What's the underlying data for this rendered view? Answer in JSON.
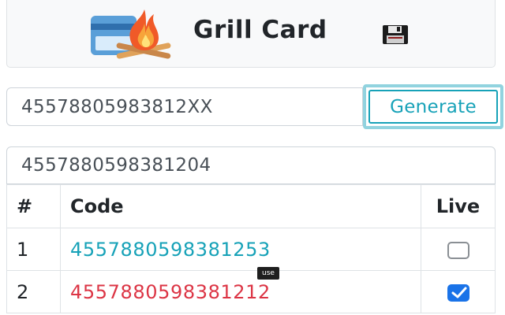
{
  "app": {
    "title": "Grill Card"
  },
  "generator": {
    "pattern_value": "45578805983812XX",
    "generate_label": "Generate"
  },
  "result": {
    "value": "4557880598381204"
  },
  "table": {
    "headers": {
      "num": "#",
      "code": "Code",
      "live": "Live"
    },
    "rows": [
      {
        "num": "1",
        "code": "4557880598381253",
        "live": false,
        "status_color": "#17a2b8"
      },
      {
        "num": "2",
        "code": "4557880598381212",
        "live": true,
        "status_color": "#dc3545"
      }
    ]
  },
  "tooltip": {
    "text": "use"
  },
  "icons": {
    "logo": "card-fire-logo-icon",
    "save": "floppy-disk-icon",
    "check": "checkmark-icon"
  },
  "colors": {
    "accent": "#17a2b8",
    "danger": "#dc3545",
    "checkbox_checked": "#1a73e8"
  }
}
